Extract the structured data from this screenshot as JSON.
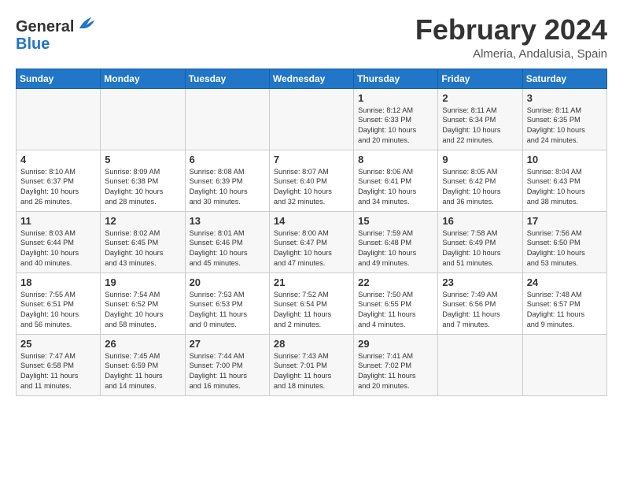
{
  "header": {
    "logo_general": "General",
    "logo_blue": "Blue",
    "month_year": "February 2024",
    "location": "Almeria, Andalusia, Spain"
  },
  "weekdays": [
    "Sunday",
    "Monday",
    "Tuesday",
    "Wednesday",
    "Thursday",
    "Friday",
    "Saturday"
  ],
  "weeks": [
    [
      {
        "day": "",
        "text": ""
      },
      {
        "day": "",
        "text": ""
      },
      {
        "day": "",
        "text": ""
      },
      {
        "day": "",
        "text": ""
      },
      {
        "day": "1",
        "text": "Sunrise: 8:12 AM\nSunset: 6:33 PM\nDaylight: 10 hours\nand 20 minutes."
      },
      {
        "day": "2",
        "text": "Sunrise: 8:11 AM\nSunset: 6:34 PM\nDaylight: 10 hours\nand 22 minutes."
      },
      {
        "day": "3",
        "text": "Sunrise: 8:11 AM\nSunset: 6:35 PM\nDaylight: 10 hours\nand 24 minutes."
      }
    ],
    [
      {
        "day": "4",
        "text": "Sunrise: 8:10 AM\nSunset: 6:37 PM\nDaylight: 10 hours\nand 26 minutes."
      },
      {
        "day": "5",
        "text": "Sunrise: 8:09 AM\nSunset: 6:38 PM\nDaylight: 10 hours\nand 28 minutes."
      },
      {
        "day": "6",
        "text": "Sunrise: 8:08 AM\nSunset: 6:39 PM\nDaylight: 10 hours\nand 30 minutes."
      },
      {
        "day": "7",
        "text": "Sunrise: 8:07 AM\nSunset: 6:40 PM\nDaylight: 10 hours\nand 32 minutes."
      },
      {
        "day": "8",
        "text": "Sunrise: 8:06 AM\nSunset: 6:41 PM\nDaylight: 10 hours\nand 34 minutes."
      },
      {
        "day": "9",
        "text": "Sunrise: 8:05 AM\nSunset: 6:42 PM\nDaylight: 10 hours\nand 36 minutes."
      },
      {
        "day": "10",
        "text": "Sunrise: 8:04 AM\nSunset: 6:43 PM\nDaylight: 10 hours\nand 38 minutes."
      }
    ],
    [
      {
        "day": "11",
        "text": "Sunrise: 8:03 AM\nSunset: 6:44 PM\nDaylight: 10 hours\nand 40 minutes."
      },
      {
        "day": "12",
        "text": "Sunrise: 8:02 AM\nSunset: 6:45 PM\nDaylight: 10 hours\nand 43 minutes."
      },
      {
        "day": "13",
        "text": "Sunrise: 8:01 AM\nSunset: 6:46 PM\nDaylight: 10 hours\nand 45 minutes."
      },
      {
        "day": "14",
        "text": "Sunrise: 8:00 AM\nSunset: 6:47 PM\nDaylight: 10 hours\nand 47 minutes."
      },
      {
        "day": "15",
        "text": "Sunrise: 7:59 AM\nSunset: 6:48 PM\nDaylight: 10 hours\nand 49 minutes."
      },
      {
        "day": "16",
        "text": "Sunrise: 7:58 AM\nSunset: 6:49 PM\nDaylight: 10 hours\nand 51 minutes."
      },
      {
        "day": "17",
        "text": "Sunrise: 7:56 AM\nSunset: 6:50 PM\nDaylight: 10 hours\nand 53 minutes."
      }
    ],
    [
      {
        "day": "18",
        "text": "Sunrise: 7:55 AM\nSunset: 6:51 PM\nDaylight: 10 hours\nand 56 minutes."
      },
      {
        "day": "19",
        "text": "Sunrise: 7:54 AM\nSunset: 6:52 PM\nDaylight: 10 hours\nand 58 minutes."
      },
      {
        "day": "20",
        "text": "Sunrise: 7:53 AM\nSunset: 6:53 PM\nDaylight: 11 hours\nand 0 minutes."
      },
      {
        "day": "21",
        "text": "Sunrise: 7:52 AM\nSunset: 6:54 PM\nDaylight: 11 hours\nand 2 minutes."
      },
      {
        "day": "22",
        "text": "Sunrise: 7:50 AM\nSunset: 6:55 PM\nDaylight: 11 hours\nand 4 minutes."
      },
      {
        "day": "23",
        "text": "Sunrise: 7:49 AM\nSunset: 6:56 PM\nDaylight: 11 hours\nand 7 minutes."
      },
      {
        "day": "24",
        "text": "Sunrise: 7:48 AM\nSunset: 6:57 PM\nDaylight: 11 hours\nand 9 minutes."
      }
    ],
    [
      {
        "day": "25",
        "text": "Sunrise: 7:47 AM\nSunset: 6:58 PM\nDaylight: 11 hours\nand 11 minutes."
      },
      {
        "day": "26",
        "text": "Sunrise: 7:45 AM\nSunset: 6:59 PM\nDaylight: 11 hours\nand 14 minutes."
      },
      {
        "day": "27",
        "text": "Sunrise: 7:44 AM\nSunset: 7:00 PM\nDaylight: 11 hours\nand 16 minutes."
      },
      {
        "day": "28",
        "text": "Sunrise: 7:43 AM\nSunset: 7:01 PM\nDaylight: 11 hours\nand 18 minutes."
      },
      {
        "day": "29",
        "text": "Sunrise: 7:41 AM\nSunset: 7:02 PM\nDaylight: 11 hours\nand 20 minutes."
      },
      {
        "day": "",
        "text": ""
      },
      {
        "day": "",
        "text": ""
      }
    ]
  ]
}
